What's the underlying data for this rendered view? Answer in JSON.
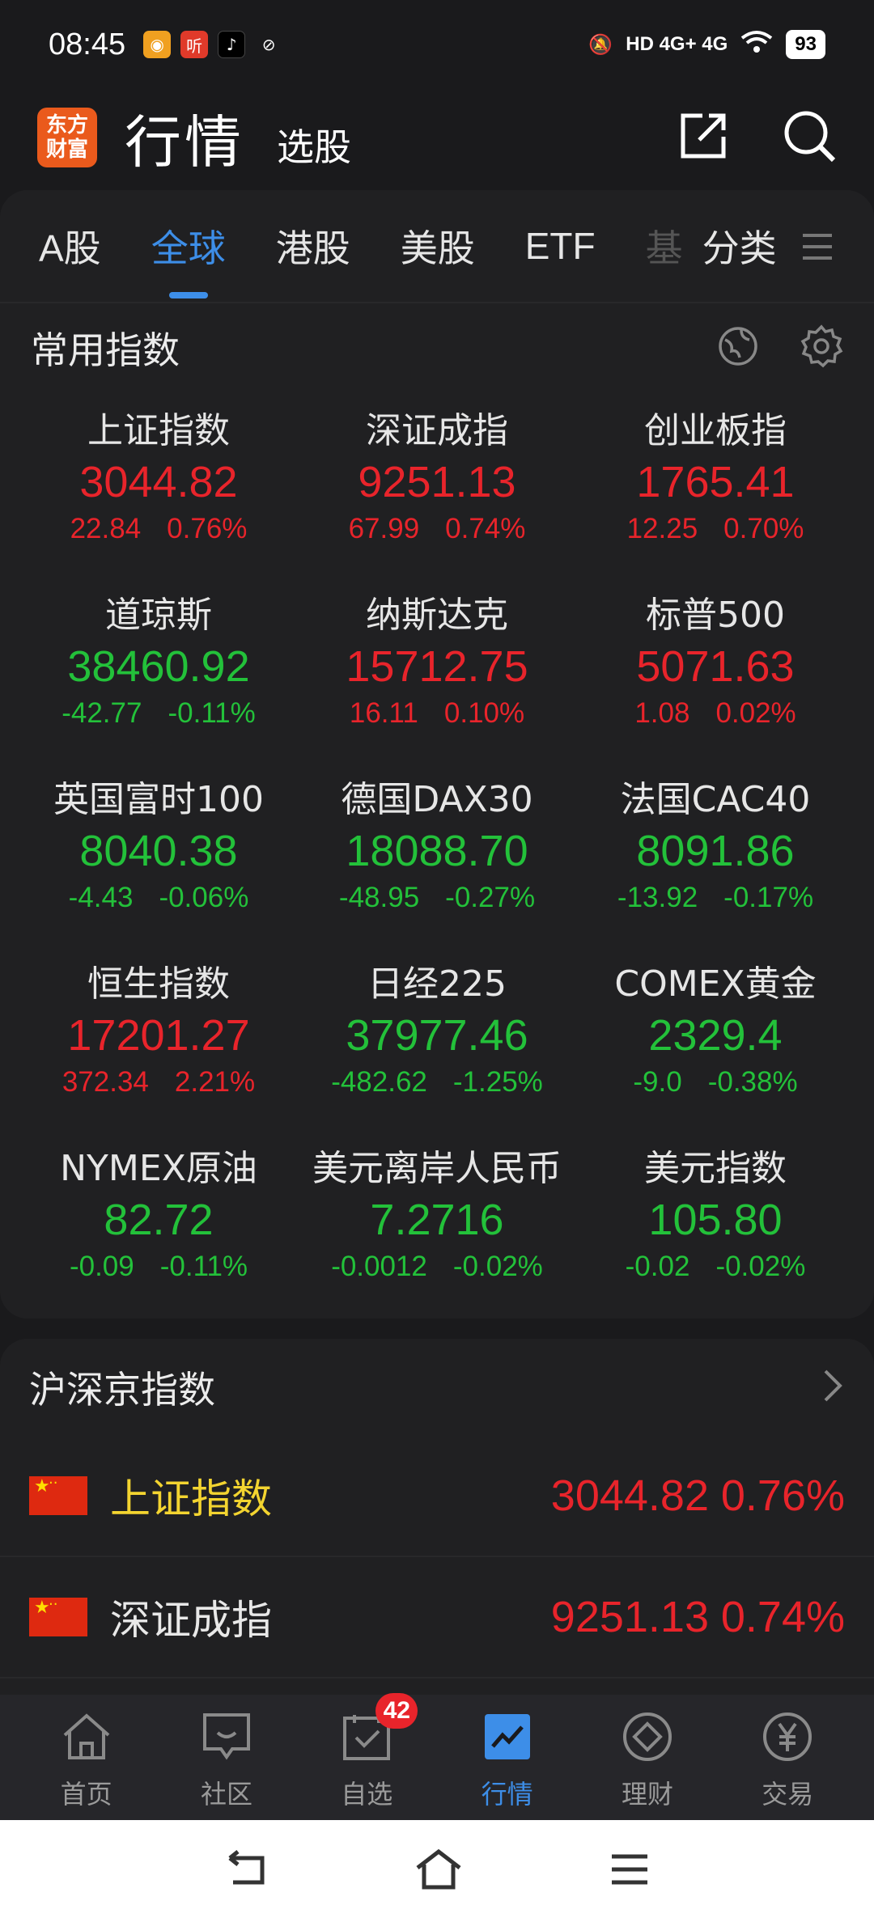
{
  "status_bar": {
    "time": "08:45",
    "network": "HD 4G+ 4G",
    "battery": "93"
  },
  "header": {
    "logo_line1": "东方",
    "logo_line2": "财富",
    "title": "行情",
    "subtitle": "选股"
  },
  "tabs": [
    {
      "label": "A股"
    },
    {
      "label": "全球"
    },
    {
      "label": "港股"
    },
    {
      "label": "美股"
    },
    {
      "label": "ETF"
    },
    {
      "label": "分类"
    }
  ],
  "tab_faded": "基",
  "common_indices": {
    "title": "常用指数",
    "items": [
      {
        "name": "上证指数",
        "price": "3044.82",
        "change": "22.84",
        "pct": "0.76%",
        "dir": "up"
      },
      {
        "name": "深证成指",
        "price": "9251.13",
        "change": "67.99",
        "pct": "0.74%",
        "dir": "up"
      },
      {
        "name": "创业板指",
        "price": "1765.41",
        "change": "12.25",
        "pct": "0.70%",
        "dir": "up"
      },
      {
        "name": "道琼斯",
        "price": "38460.92",
        "change": "-42.77",
        "pct": "-0.11%",
        "dir": "down"
      },
      {
        "name": "纳斯达克",
        "price": "15712.75",
        "change": "16.11",
        "pct": "0.10%",
        "dir": "up"
      },
      {
        "name": "标普500",
        "price": "5071.63",
        "change": "1.08",
        "pct": "0.02%",
        "dir": "up"
      },
      {
        "name": "英国富时100",
        "price": "8040.38",
        "change": "-4.43",
        "pct": "-0.06%",
        "dir": "down"
      },
      {
        "name": "德国DAX30",
        "price": "18088.70",
        "change": "-48.95",
        "pct": "-0.27%",
        "dir": "down"
      },
      {
        "name": "法国CAC40",
        "price": "8091.86",
        "change": "-13.92",
        "pct": "-0.17%",
        "dir": "down"
      },
      {
        "name": "恒生指数",
        "price": "17201.27",
        "change": "372.34",
        "pct": "2.21%",
        "dir": "up"
      },
      {
        "name": "日经225",
        "price": "37977.46",
        "change": "-482.62",
        "pct": "-1.25%",
        "dir": "down"
      },
      {
        "name": "COMEX黄金",
        "price": "2329.4",
        "change": "-9.0",
        "pct": "-0.38%",
        "dir": "down"
      },
      {
        "name": "NYMEX原油",
        "price": "82.72",
        "change": "-0.09",
        "pct": "-0.11%",
        "dir": "down"
      },
      {
        "name": "美元离岸人民币",
        "price": "7.2716",
        "change": "-0.0012",
        "pct": "-0.02%",
        "dir": "down"
      },
      {
        "name": "美元指数",
        "price": "105.80",
        "change": "-0.02",
        "pct": "-0.02%",
        "dir": "down"
      }
    ]
  },
  "hs_indices": {
    "title": "沪深京指数",
    "rows": [
      {
        "name": "上证指数",
        "price": "3044.82",
        "pct": "0.76%",
        "highlight": true
      },
      {
        "name": "深证成指",
        "price": "9251.13",
        "pct": "0.74%",
        "highlight": false
      }
    ]
  },
  "bottom_nav": [
    {
      "label": "首页",
      "icon": "home-icon"
    },
    {
      "label": "社区",
      "icon": "community-icon"
    },
    {
      "label": "自选",
      "icon": "watchlist-icon",
      "badge": "42"
    },
    {
      "label": "行情",
      "icon": "market-icon",
      "active": true
    },
    {
      "label": "理财",
      "icon": "wealth-icon"
    },
    {
      "label": "交易",
      "icon": "trade-icon"
    }
  ],
  "colors": {
    "up": "#e8242b",
    "down": "#23c13a",
    "accent": "#3d8ee8",
    "logo": "#ea5a1c"
  }
}
